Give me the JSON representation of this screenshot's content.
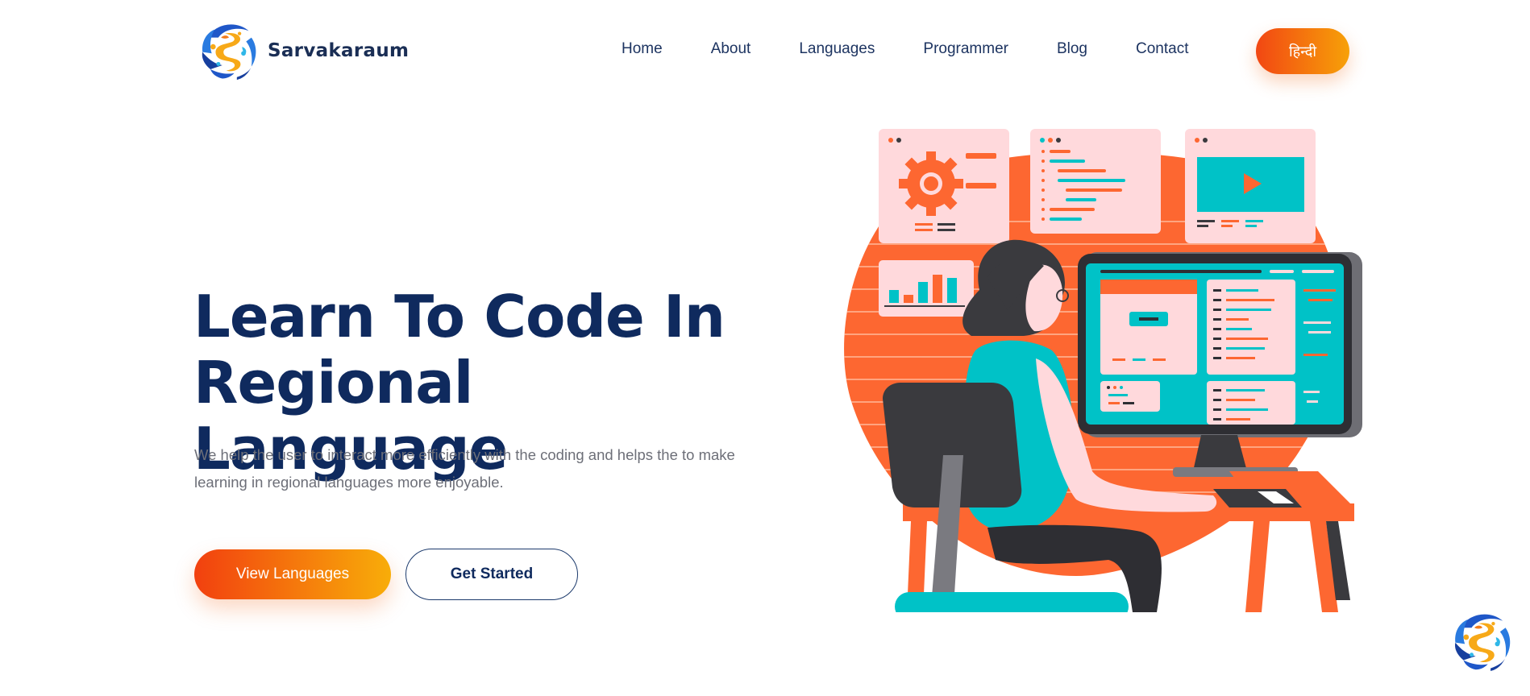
{
  "brand": {
    "name": "Sarvakaraum",
    "logo_icon": "swirl-s-logo-icon"
  },
  "nav": {
    "links": [
      "Home",
      "About",
      "Languages",
      "Programmer",
      "Blog",
      "Contact"
    ],
    "language_button": "हिन्दी"
  },
  "hero": {
    "title_line1": "Learn To Code In",
    "title_line2": "Regional Language",
    "description": "We help the user to interact more efficiently with the coding and helps the to make learning in regional languages more enjoyable.",
    "primary_button": "View Languages",
    "secondary_button": "Get Started"
  },
  "colors": {
    "accent_orange": "#f24713",
    "accent_yellow": "#f7a108",
    "navy": "#0f2a5e",
    "illustration_teal": "#00c2c7",
    "illustration_pink": "#fddadd"
  },
  "chat_widget": {
    "icon": "swirl-s-logo-icon"
  }
}
